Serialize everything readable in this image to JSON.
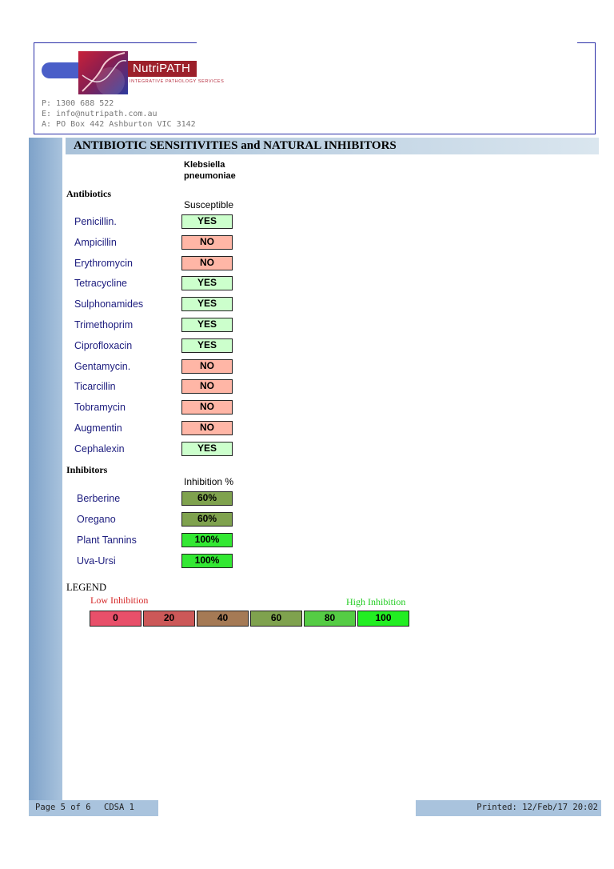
{
  "header": {
    "logo_name": "NutriPATH",
    "logo_tagline": "INTEGRATIVE PATHOLOGY SERVICES",
    "contact_phone": "P: 1300 688 522",
    "contact_email": "E: info@nutripath.com.au",
    "contact_address": "A: PO Box 442 Ashburton VIC 3142"
  },
  "section": {
    "title": "ANTIBIOTIC SENSITIVITIES and NATURAL INHIBITORS",
    "organism_line1": "Klebsiella",
    "organism_line2": "pneumoniae"
  },
  "antibiotics": {
    "heading": "Antibiotics",
    "column_heading": "Susceptible",
    "rows": [
      {
        "name": "Penicillin.",
        "result": "YES"
      },
      {
        "name": "Ampicillin",
        "result": "NO"
      },
      {
        "name": "Erythromycin",
        "result": "NO"
      },
      {
        "name": "Tetracycline",
        "result": "YES"
      },
      {
        "name": "Sulphonamides",
        "result": "YES"
      },
      {
        "name": "Trimethoprim",
        "result": "YES"
      },
      {
        "name": "Ciprofloxacin",
        "result": "YES"
      },
      {
        "name": "Gentamycin.",
        "result": "NO"
      },
      {
        "name": "Ticarcillin",
        "result": "NO"
      },
      {
        "name": "Tobramycin",
        "result": "NO"
      },
      {
        "name": "Augmentin",
        "result": "NO"
      },
      {
        "name": "Cephalexin",
        "result": "YES"
      }
    ]
  },
  "inhibitors": {
    "heading": "Inhibitors",
    "column_heading": "Inhibition %",
    "rows": [
      {
        "name": "Berberine",
        "value": "60%"
      },
      {
        "name": "Oregano",
        "value": "60%"
      },
      {
        "name": "Plant Tannins",
        "value": "100%"
      },
      {
        "name": "Uva-Ursi",
        "value": "100%"
      }
    ]
  },
  "legend": {
    "title": "LEGEND",
    "low_label": "Low Inhibition",
    "high_label": "High Inhibition",
    "cells": [
      {
        "label": "0",
        "color": "#e8506a"
      },
      {
        "label": "20",
        "color": "#cc5858"
      },
      {
        "label": "40",
        "color": "#a57a55"
      },
      {
        "label": "60",
        "color": "#7fa24e"
      },
      {
        "label": "80",
        "color": "#55cc44"
      },
      {
        "label": "100",
        "color": "#22ee22"
      }
    ]
  },
  "colors": {
    "yes_fill": "#ccffcc",
    "no_fill": "#ffb6a6",
    "label_text": "#1c1c7e",
    "frame": "#2b2fa8"
  },
  "footer": {
    "page": "Page 5 of 6",
    "doc": "CDSA 1",
    "printed": "Printed: 12/Feb/17 20:02"
  }
}
